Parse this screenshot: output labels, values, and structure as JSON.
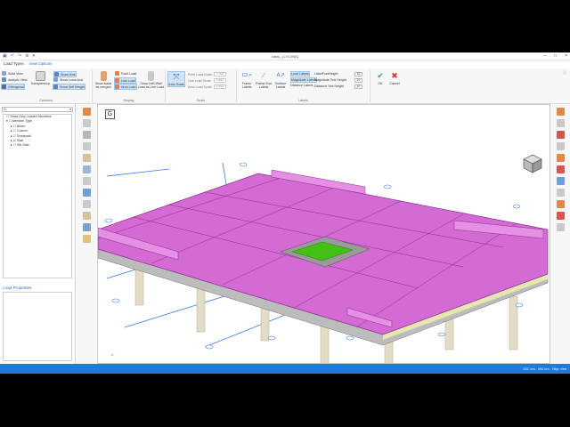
{
  "window": {
    "title": "Ideio - [LH-ONS]",
    "controls": [
      "–",
      "□",
      "×"
    ]
  },
  "menu": {
    "items": [
      "Load Types",
      "View Options"
    ]
  },
  "ribbon": {
    "common": {
      "label": "Common",
      "solid_view": "Solid View",
      "analytic_view": "Analytic View",
      "orthogonal": "Orthogonal",
      "transparency": "Transparency",
      "show_axis": "Show Axis",
      "show_local_axis": "Show Local Axis",
      "show_self_weight": "Show Self Weight",
      "show_loads_as_merged": "Show loads as merged"
    },
    "display": {
      "label": "Display",
      "point_load": "Point Load",
      "line_load": "Line Load",
      "area_load": "Area Load",
      "show_infill_wall": "Show Infill Wall Load as Line Load"
    },
    "scale": {
      "label": "Scale",
      "auto_scale": "Auto Scale",
      "point_load_scale": "Point Load Scale",
      "line_load_scale": "Line Load Scale",
      "area_load_scale": "Area Load Scale",
      "point_load_scale_value": "1.000",
      "line_load_scale_value": "0.500",
      "area_load_scale_value": "0.500"
    },
    "labels": {
      "label": "Labels",
      "frame_labels": "Frame Labels",
      "frame_end_labels": "Frame End Labels",
      "surface_labels": "Surface Labels",
      "load_labels": "Load Labels",
      "magnitude_labels": "Magnitude Labels",
      "distance_labels": "Distance Labels",
      "label_font_height": "LabelFontHeight",
      "magnitude_text_height": "Magnitude Text Height",
      "distance_text_height": "Distance Text Height",
      "label_font_height_value": "10",
      "magnitude_text_height_value": "10",
      "distance_text_height_value": "10"
    },
    "ok": "OK",
    "cancel": "Cancel"
  },
  "left_panel": {
    "selector": "G",
    "tree": {
      "show_only_loaded": "Show Only Loaded Members",
      "member_type": "Member Type",
      "items": [
        "Beam",
        "Column",
        "Shearwall",
        "Slab",
        "Rib Slab"
      ]
    },
    "load_properties_title": "Load Properties"
  },
  "viewport": {
    "badge": "G",
    "axis_labels": [
      "z",
      "x",
      "y"
    ],
    "colors": {
      "slab": "#d46ad4",
      "slab_edge": "#8a2f8a",
      "opening": "#44c014",
      "column": "#e3dcc6",
      "beam_blue": "#3c7ee0"
    }
  },
  "status": {
    "text": "GD: cm , kN/ cm , Sbp: mm"
  },
  "colors": {
    "accent": "#1e7bd7",
    "selected": "#cfe3f7"
  }
}
